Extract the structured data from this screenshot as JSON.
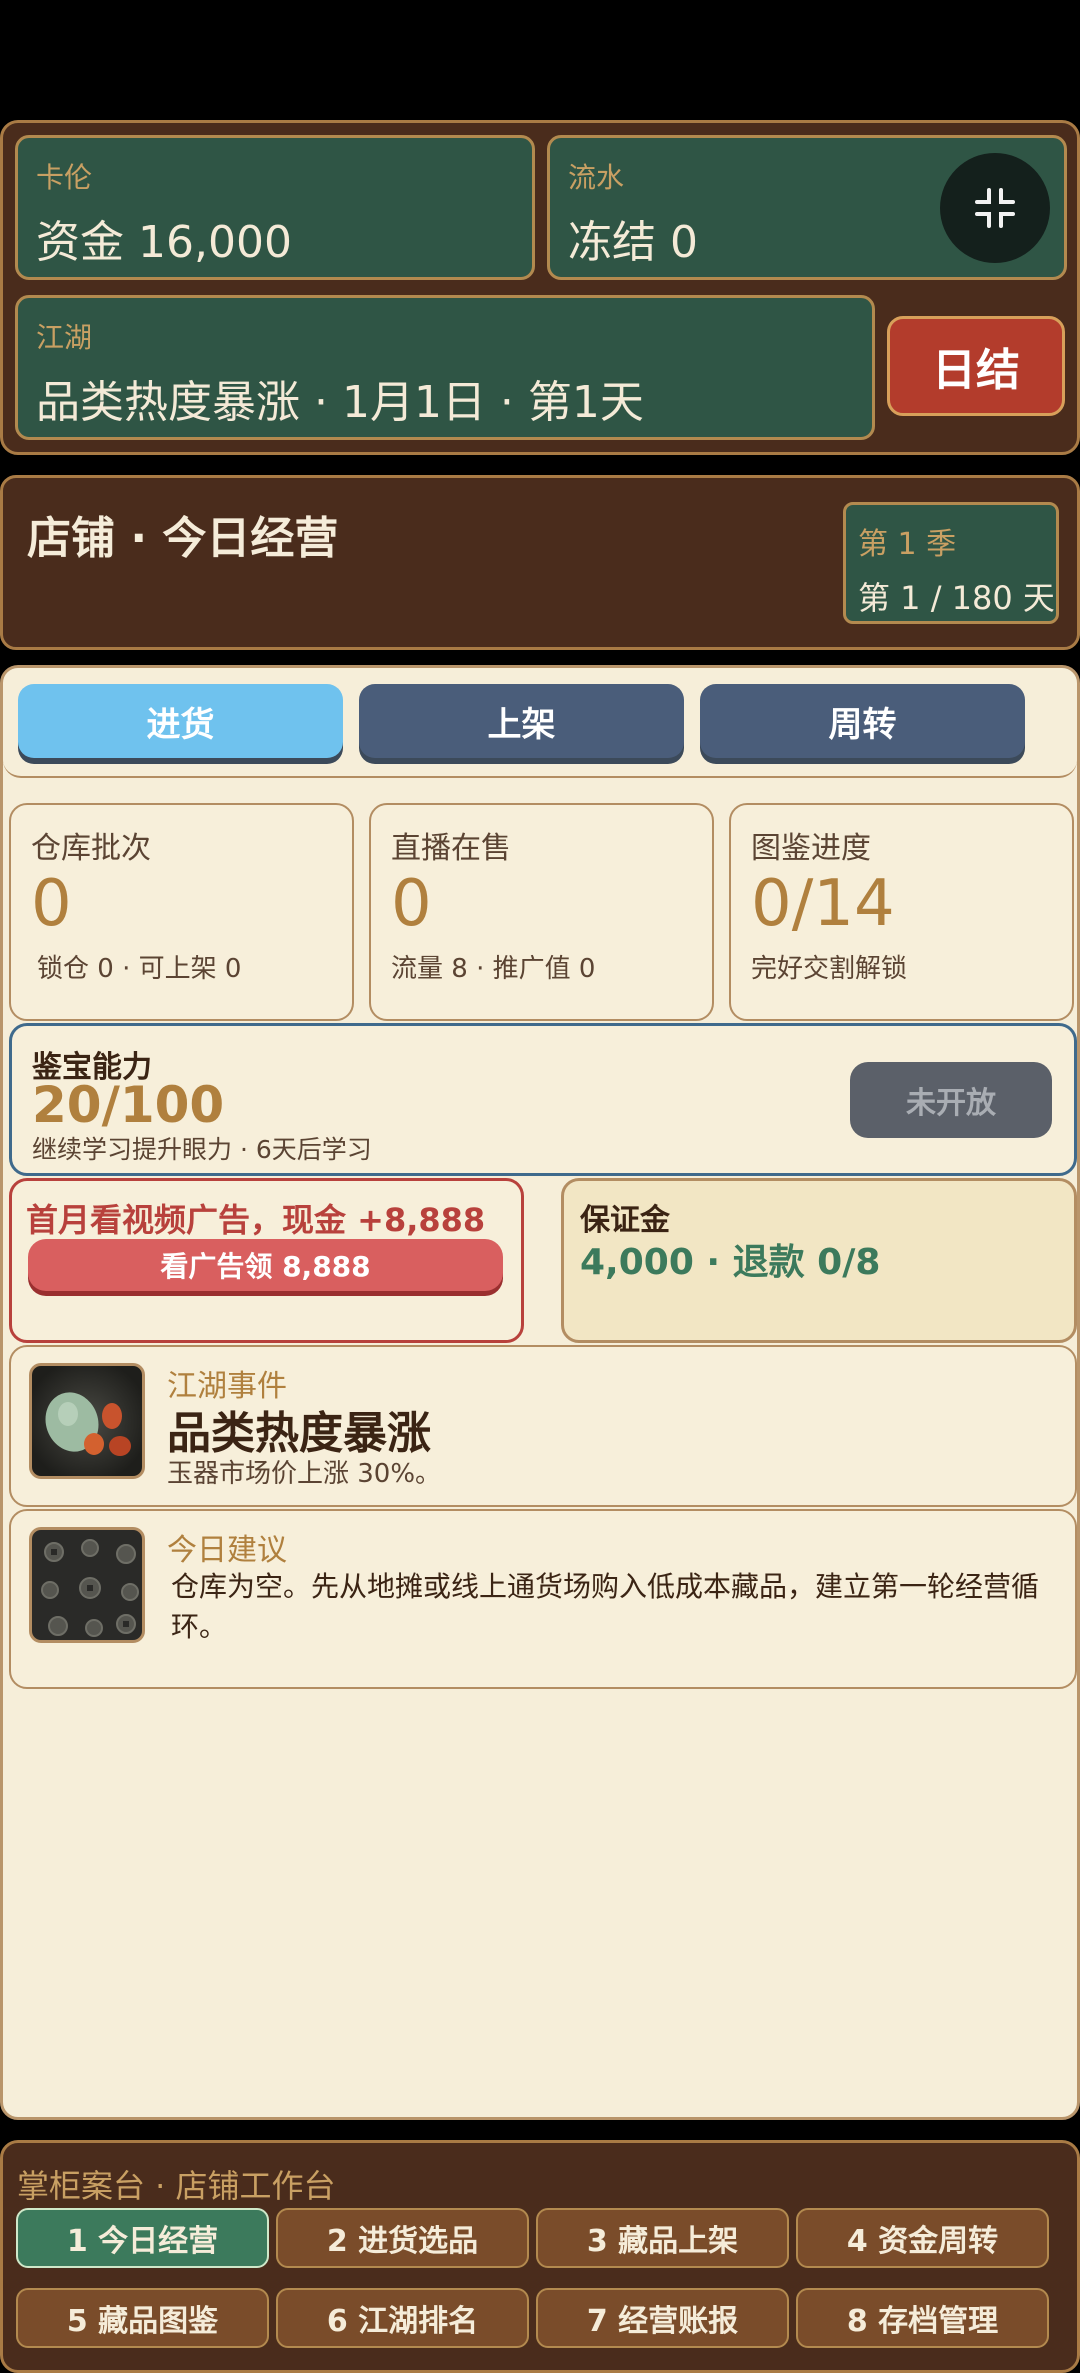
{
  "header": {
    "player_label": "卡伦",
    "funds": "资金 16,000",
    "flow_label": "流水",
    "frozen": "冻结 0",
    "jianghu_label": "江湖",
    "event_line": "品类热度暴涨 · 1月1日 · 第1天",
    "end_day_button": "日结"
  },
  "shop": {
    "title": "店铺 · 今日经营",
    "season": "第 1 季",
    "day_progress": "第 1 / 180 天"
  },
  "tabs": [
    {
      "label": "进货",
      "active": true
    },
    {
      "label": "上架",
      "active": false
    },
    {
      "label": "周转",
      "active": false
    }
  ],
  "cards": {
    "warehouse": {
      "label": "仓库批次",
      "value": "0",
      "sub": "锁仓 0 · 可上架 0"
    },
    "live": {
      "label": "直播在售",
      "value": "0",
      "sub": "流量 8 · 推广值 0"
    },
    "catalog": {
      "label": "图鉴进度",
      "value": "0/14",
      "sub": "完好交割解锁"
    }
  },
  "appraisal": {
    "label": "鉴宝能力",
    "value": "20/100",
    "sub": "继续学习提升眼力 · 6天后学习",
    "button": "未开放"
  },
  "ad": {
    "title": "首月看视频广告，现金 +8,888",
    "button": "看广告领 8,888"
  },
  "deposit": {
    "label": "保证金",
    "value": "4,000 · 退款 0/8"
  },
  "event": {
    "tag": "江湖事件",
    "title": "品类热度暴涨",
    "desc": "玉器市场价上涨 30%。"
  },
  "advice": {
    "tag": "今日建议",
    "text": "仓库为空。先从地摊或线上通货场购入低成本藏品，建立第一轮经营循环。"
  },
  "nav": {
    "title": "掌柜案台 · 店铺工作台",
    "items": [
      {
        "label": "1 今日经营",
        "active": true
      },
      {
        "label": "2 进货选品",
        "active": false
      },
      {
        "label": "3 藏品上架",
        "active": false
      },
      {
        "label": "4 资金周转",
        "active": false
      },
      {
        "label": "5 藏品图鉴",
        "active": false
      },
      {
        "label": "6 江湖排名",
        "active": false
      },
      {
        "label": "7 经营账报",
        "active": false
      },
      {
        "label": "8 存档管理",
        "active": false
      }
    ]
  },
  "colors": {
    "panel_brown": "#4a2c1c",
    "panel_green": "#2f5545",
    "accent_gold": "#b0803e",
    "tab_active": "#6fc2ee",
    "tab_inactive": "#4a5d7a",
    "danger_red": "#b33c2c"
  }
}
